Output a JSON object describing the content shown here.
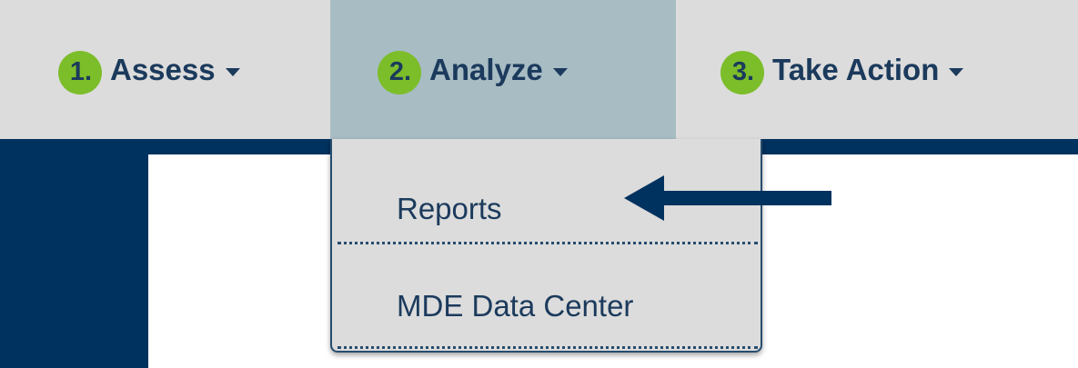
{
  "nav": {
    "items": [
      {
        "step": "1.",
        "label": "Assess",
        "active": false
      },
      {
        "step": "2.",
        "label": "Analyze",
        "active": true
      },
      {
        "step": "3.",
        "label": "Take Action",
        "active": false
      }
    ]
  },
  "dropdown": {
    "items": [
      {
        "label": "Reports"
      },
      {
        "label": "MDE Data Center"
      }
    ]
  },
  "colors": {
    "nav_background": "#dcdcdc",
    "active_tab": "#a8bcc4",
    "badge_green": "#7cbd2a",
    "navy": "#00325f",
    "text": "#1b3a5c"
  },
  "annotation": {
    "icon": "left-arrow-icon",
    "points_to": "Reports"
  }
}
